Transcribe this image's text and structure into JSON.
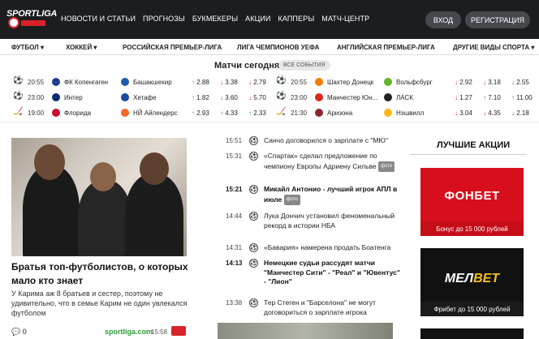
{
  "header": {
    "logo_text": "SPORTLIGA",
    "nav": [
      "НОВОСТИ И СТАТЬИ",
      "ПРОГНОЗЫ",
      "БУКМЕКЕРЫ",
      "АКЦИИ",
      "КАППЕРЫ",
      "МАТЧ-ЦЕНТР"
    ],
    "login": "ВХОД",
    "register": "РЕГИСТРАЦИЯ"
  },
  "subnav": [
    "ФУТБОЛ ▾",
    "ХОККЕЙ ▾",
    "РОССИЙСКАЯ ПРЕМЬЕР-ЛИГА",
    "ЛИГА ЧЕМПИОНОВ УЕФА",
    "АНГЛИЙСКАЯ ПРЕМЬЕР-ЛИГА",
    "ДРУГИЕ ВИДЫ СПОРТА ▾"
  ],
  "matches": {
    "title": "Матчи сегодня",
    "all_events": "ВСЕ СОБЫТИЯ",
    "left": [
      {
        "time": "20:55",
        "home": "ФК Копенгаген",
        "away": "Башакшехир",
        "o1": "2.88",
        "ox": "3.38",
        "o2": "2.79",
        "d1": "up",
        "dx": "dn",
        "d2": "dn",
        "icon": "⚽",
        "c1": "#1d3f8f",
        "c2": "#1e5ba8"
      },
      {
        "time": "23:00",
        "home": "Интер",
        "away": "Хетафе",
        "o1": "1.82",
        "ox": "3.60",
        "o2": "5.70",
        "d1": "up",
        "dx": "dn",
        "d2": "dn",
        "icon": "⚽",
        "c1": "#0b2a72",
        "c2": "#1a4aa3"
      },
      {
        "time": "19:00",
        "home": "Флорида",
        "away": "НЙ Айлендерс",
        "o1": "2.93",
        "ox": "4.33",
        "o2": "2.33",
        "d1": "up",
        "dx": "up",
        "d2": "up",
        "icon": "🏒",
        "c1": "#c8102e",
        "c2": "#f26924"
      }
    ],
    "right": [
      {
        "time": "20:55",
        "home": "Шахтер Донецк",
        "away": "Вольфсбург",
        "o1": "2.92",
        "ox": "3.18",
        "o2": "2.55",
        "d1": "dn",
        "dx": "dn",
        "d2": "dn",
        "icon": "⚽",
        "c1": "#f57c00",
        "c2": "#65b32e"
      },
      {
        "time": "23:00",
        "home": "Манчестер Юн...",
        "away": "ЛАСК",
        "o1": "1.27",
        "ox": "7.10",
        "o2": "11.00",
        "d1": "dn",
        "dx": "up",
        "d2": "up",
        "icon": "⚽",
        "c1": "#da291c",
        "c2": "#222222"
      },
      {
        "time": "21:30",
        "home": "Аризона",
        "away": "Нэшвилл",
        "o1": "3.04",
        "ox": "4.35",
        "o2": "2.18",
        "d1": "dn",
        "dx": "dn",
        "d2": "dn",
        "icon": "🏒",
        "c1": "#8c2633",
        "c2": "#ffb81c"
      }
    ]
  },
  "article": {
    "title": "Братья топ-футболистов, о которых мало кто знает",
    "lead": "У Карима аж 8 братьев и сестер, поэтому не удивительно, что в семье Карим не один увлекался футболом",
    "comments": "0",
    "source": "sportliga.com",
    "time": "15:58"
  },
  "news": [
    {
      "time": "15:51",
      "title": "Санчо договорился о зарплате с \"МЮ\"",
      "bold": false,
      "tag": ""
    },
    {
      "time": "15:31",
      "title": "«Спартак» сделал предложение по чемпиону Европы Адриену Сильве",
      "bold": false,
      "tag": "фото"
    },
    {
      "time": "15:21",
      "title": "Микайл Антонио - лучший игрок АПЛ в июле",
      "bold": true,
      "tag": "фото"
    },
    {
      "time": "14:44",
      "title": "Лука Дончич установил феноменальный рекорд в истории НБА",
      "bold": false,
      "tag": ""
    },
    {
      "time": "14:31",
      "title": "«Бавария» намерена продать Боатенга",
      "bold": false,
      "tag": ""
    },
    {
      "time": "14:13",
      "title": "Немецкие судьи рассудят матчи \"Манчестер Сити\" - \"Реал\" и \"Ювентус\" - \"Лион\"",
      "bold": true,
      "tag": ""
    },
    {
      "time": "13:38",
      "title": "Тер Стеген и \"Барселона\" не могут договориться о зарплате игрока",
      "bold": false,
      "tag": ""
    }
  ],
  "promos": {
    "title": "ЛУЧШИЕ АКЦИИ",
    "items": [
      {
        "brand": "ФОНБЕТ",
        "text": "Бонус до 15 000 рублей"
      },
      {
        "brand_a": "МЕЛ",
        "brand_b": "BET",
        "text": "Фрибет до 15 000 рублей"
      }
    ]
  },
  "colors": {
    "header_bg": "#1c1d1f",
    "accent_red": "#d8232a",
    "odd_up": "#27a13b",
    "odd_down": "#dd2222",
    "source_green": "#2a9d3b"
  }
}
